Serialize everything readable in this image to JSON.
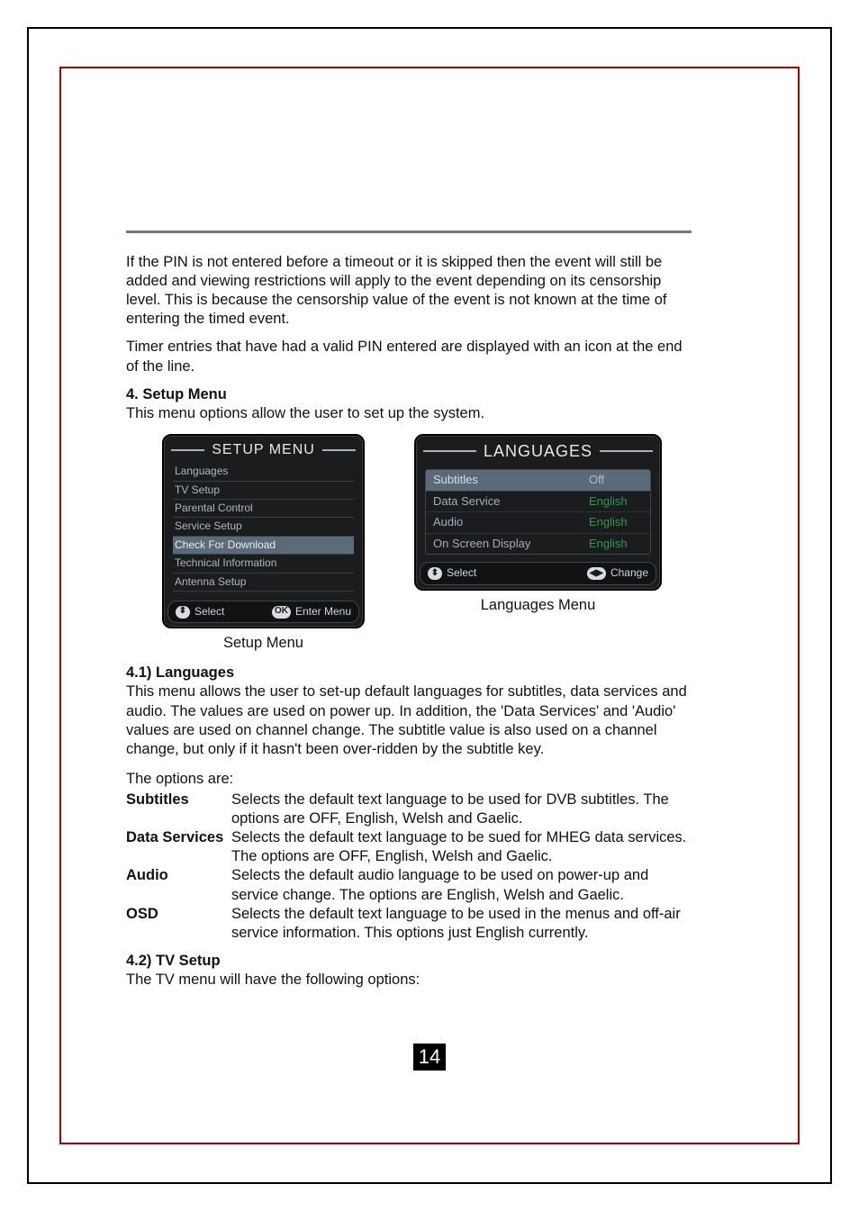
{
  "body": {
    "p1": "If the PIN is not entered before a timeout or it is skipped then the event will still be added and viewing restrictions will apply to the event depending on its censorship level. This is because the censorship value of the event is not known at the time of entering the timed event.",
    "p2": "Timer entries that have had a valid PIN entered are displayed with an icon at the end of the line.",
    "h1": "4. Setup Menu",
    "p3": "This menu options  allow the user to set up the system.",
    "h2": "4.1) Languages",
    "p4": "This menu allows the user to set-up default languages for subtitles, data services and audio. The values are used on power up. In addition, the 'Data Services' and 'Audio' values are used on channel change. The subtitle value is also used on a channel change, but only if it hasn't been over-ridden by the subtitle key.",
    "opts_intro": "The options are:",
    "opts": [
      {
        "k": "Subtitles",
        "v": "Selects the default text language to be used for DVB subtitles. The options are OFF, English, Welsh and Gaelic."
      },
      {
        "k": "Data Services",
        "v": "Selects the default text language to be sued for MHEG data services. The options are OFF, English, Welsh and Gaelic."
      },
      {
        "k": "Audio",
        "v": "Selects the default audio language to be used on power-up and service change. The options are English, Welsh and Gaelic."
      },
      {
        "k": "OSD",
        "v": "Selects the default text language to be used in the menus and off-air service information. This options just English currently."
      }
    ],
    "h3": "4.2) TV Setup",
    "p5": "The TV menu will have the following options:"
  },
  "fig1": {
    "title": "SETUP MENU",
    "items": [
      "Languages",
      "TV Setup",
      "Parental Control",
      "Service Setup",
      "Check For Download",
      "Technical Information",
      "Antenna Setup"
    ],
    "highlight_index": 4,
    "footer_left_icon": "⬍",
    "footer_left": "Select",
    "footer_right_icon": "OK",
    "footer_right": "Enter Menu",
    "caption": "Setup Menu"
  },
  "fig2": {
    "title": "LANGUAGES",
    "rows": [
      {
        "k": "Subtitles",
        "v": "Off",
        "sel": true
      },
      {
        "k": "Data Service",
        "v": "English"
      },
      {
        "k": "Audio",
        "v": "English"
      },
      {
        "k": "On Screen Display",
        "v": "English"
      }
    ],
    "footer_left_icon": "⬍",
    "footer_left": "Select",
    "footer_right_icon": "◀▶",
    "footer_right": "Change",
    "caption": "Languages Menu"
  },
  "page_number": "14"
}
